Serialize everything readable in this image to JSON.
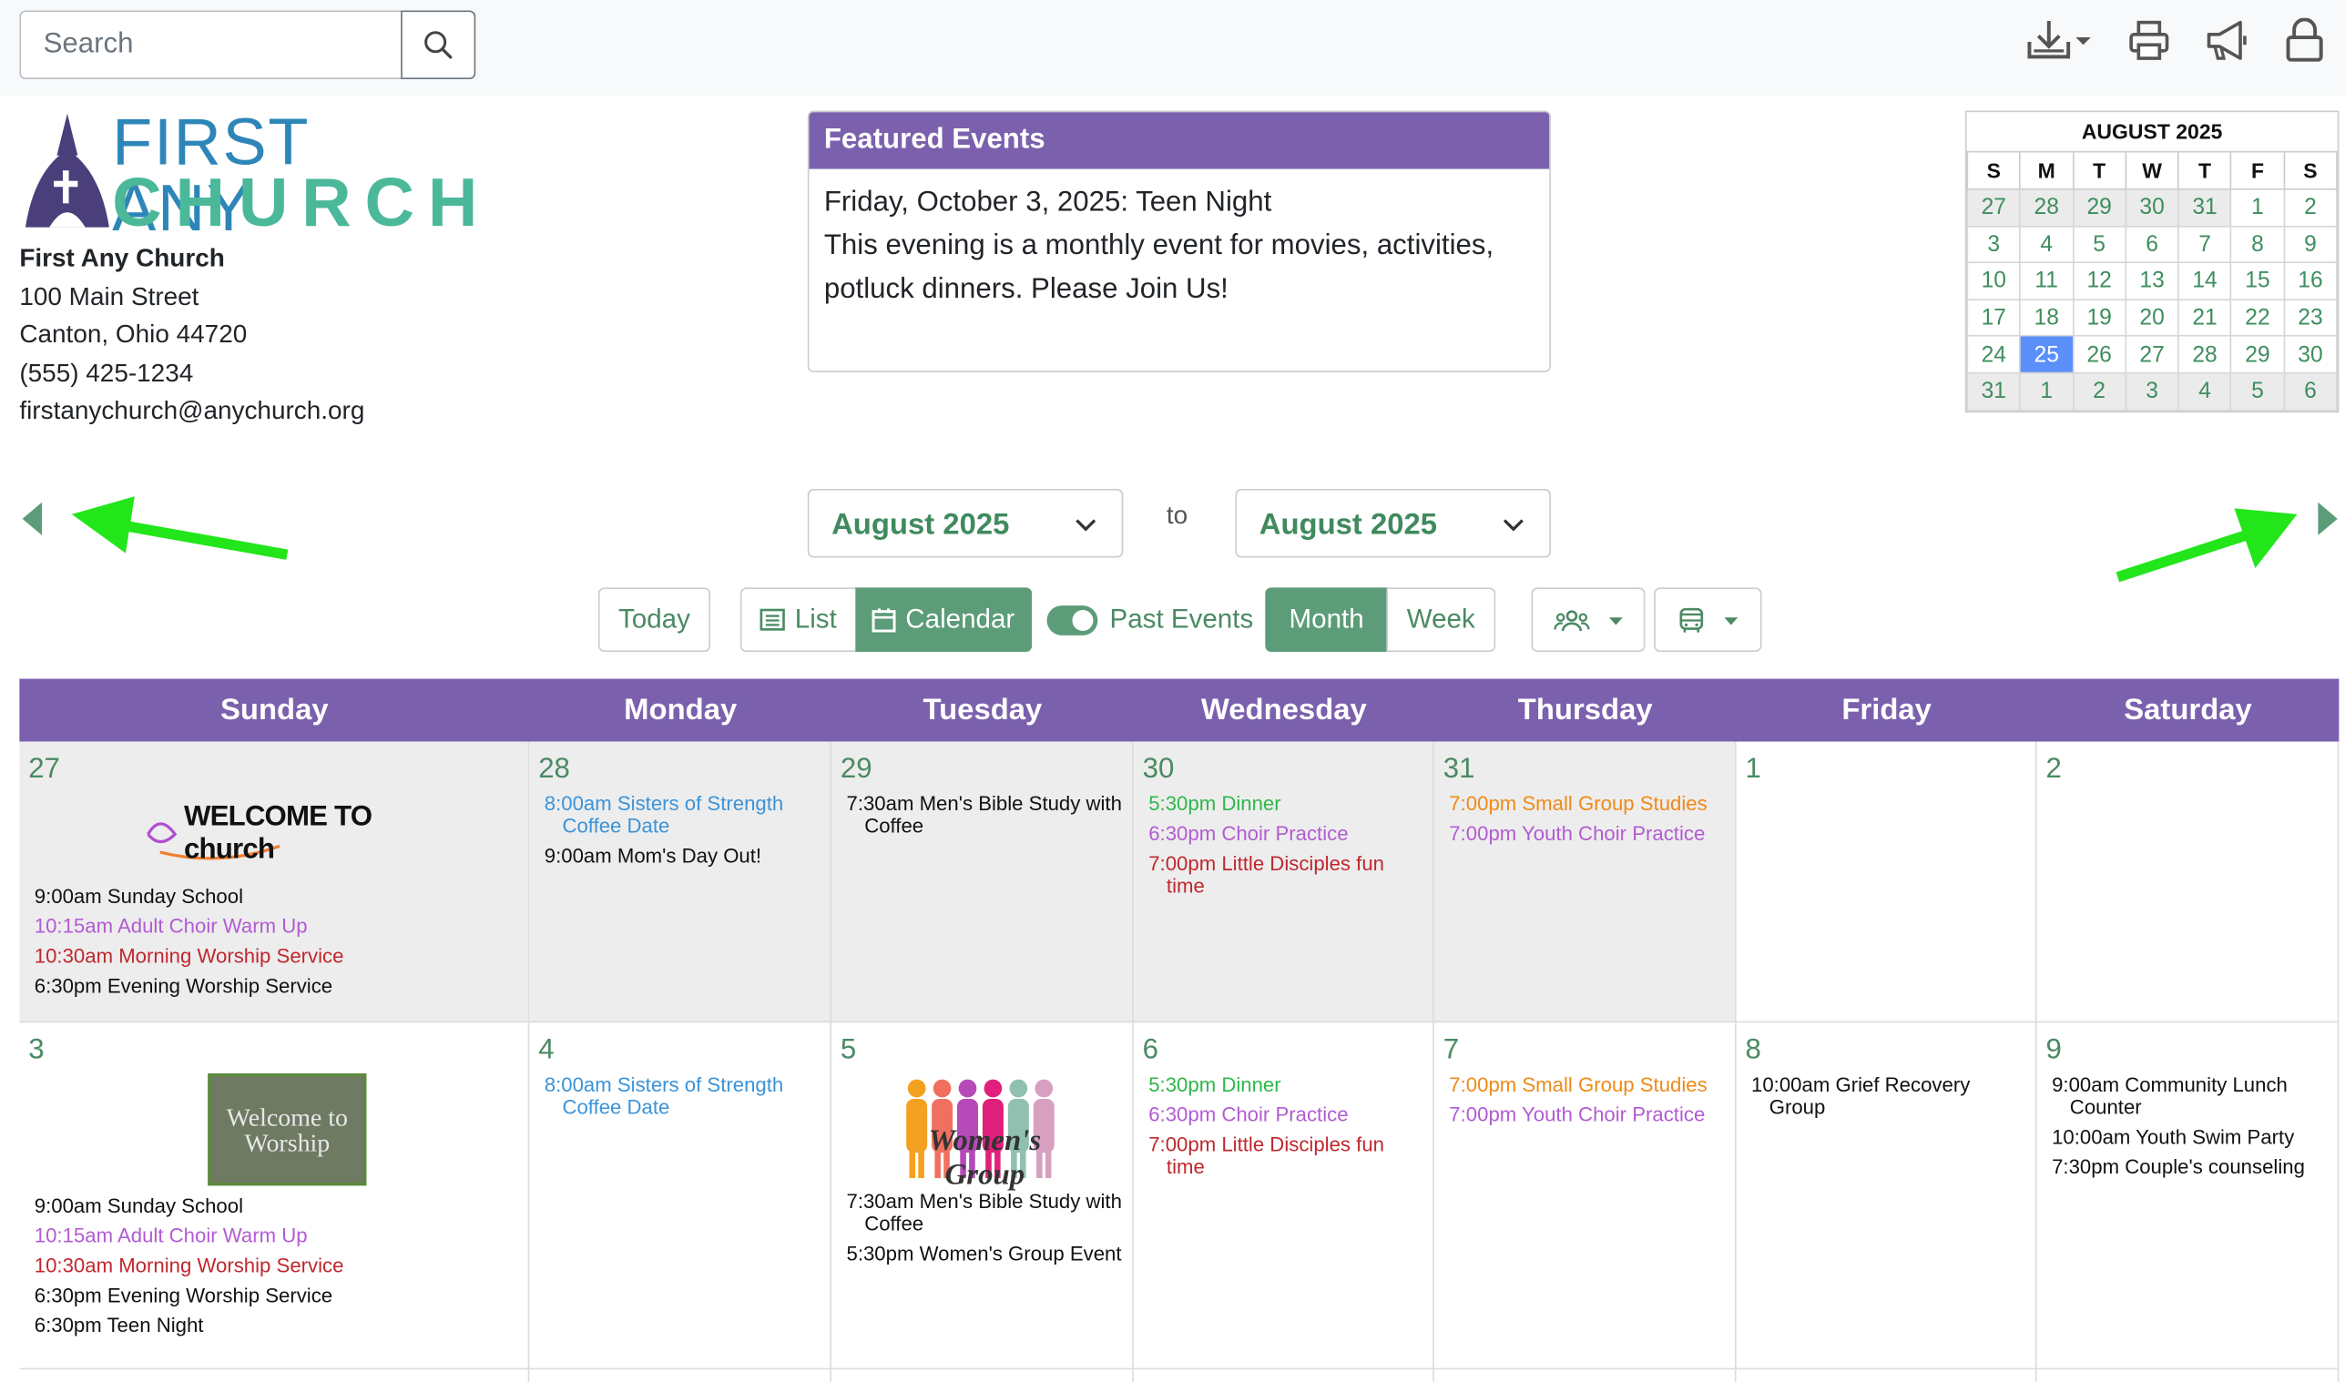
{
  "search": {
    "placeholder": "Search"
  },
  "church": {
    "logo_line1": "FIRST ANY",
    "logo_line2": "CHURCH",
    "name": "First Any Church",
    "address1": "100 Main Street",
    "address2": "Canton, Ohio 44720",
    "phone": "(555) 425-1234",
    "email": "firstanychurch@anychurch.org"
  },
  "featured": {
    "title": "Featured Events",
    "line1": "Friday, October 3, 2025: Teen Night",
    "line2": "This evening is a monthly event for movies, activities, potluck dinners. Please Join Us!"
  },
  "mini_calendar": {
    "title": "AUGUST 2025",
    "weekdays": [
      "S",
      "M",
      "T",
      "W",
      "T",
      "F",
      "S"
    ],
    "weeks": [
      [
        "27",
        "28",
        "29",
        "30",
        "31",
        "1",
        "2"
      ],
      [
        "3",
        "4",
        "5",
        "6",
        "7",
        "8",
        "9"
      ],
      [
        "10",
        "11",
        "12",
        "13",
        "14",
        "15",
        "16"
      ],
      [
        "17",
        "18",
        "19",
        "20",
        "21",
        "22",
        "23"
      ],
      [
        "24",
        "25",
        "26",
        "27",
        "28",
        "29",
        "30"
      ],
      [
        "31",
        "1",
        "2",
        "3",
        "4",
        "5",
        "6"
      ]
    ],
    "today": "25"
  },
  "range": {
    "from": "August 2025",
    "to_label": "to",
    "to": "August 2025"
  },
  "toolbar": {
    "today": "Today",
    "list": "List",
    "calendar": "Calendar",
    "past_events": "Past Events",
    "month": "Month",
    "week": "Week"
  },
  "calendar": {
    "days": [
      "Sunday",
      "Monday",
      "Tuesday",
      "Wednesday",
      "Thursday",
      "Friday",
      "Saturday"
    ],
    "image_texts": {
      "welcome_church": "WELCOME TO church",
      "welcome_worship": "Welcome to Worship",
      "womens_group": "Women's Group"
    },
    "week1": [
      {
        "day": "27",
        "events": [
          {
            "text": "9:00am Sunday School",
            "color": "black"
          },
          {
            "text": "10:15am Adult Choir Warm Up",
            "color": "purple"
          },
          {
            "text": "10:30am Morning Worship Service",
            "color": "red"
          },
          {
            "text": "6:30pm Evening Worship Service",
            "color": "black"
          }
        ]
      },
      {
        "day": "28",
        "events": [
          {
            "text": "8:00am Sisters of Strength Coffee Date",
            "color": "blue"
          },
          {
            "text": "9:00am Mom's Day Out!",
            "color": "black"
          }
        ]
      },
      {
        "day": "29",
        "events": [
          {
            "text": "7:30am Men's Bible Study with Coffee",
            "color": "black"
          }
        ]
      },
      {
        "day": "30",
        "events": [
          {
            "text": "5:30pm Dinner",
            "color": "green"
          },
          {
            "text": "6:30pm Choir Practice",
            "color": "purple"
          },
          {
            "text": "7:00pm Little Disciples fun time",
            "color": "red"
          }
        ]
      },
      {
        "day": "31",
        "events": [
          {
            "text": "7:00pm Small Group Studies",
            "color": "orange"
          },
          {
            "text": "7:00pm Youth Choir Practice",
            "color": "purple"
          }
        ]
      },
      {
        "day": "1",
        "events": []
      },
      {
        "day": "2",
        "events": []
      }
    ],
    "week2": [
      {
        "day": "3",
        "events": [
          {
            "text": "9:00am Sunday School",
            "color": "black"
          },
          {
            "text": "10:15am Adult Choir Warm Up",
            "color": "purple"
          },
          {
            "text": "10:30am Morning Worship Service",
            "color": "red"
          },
          {
            "text": "6:30pm Evening Worship Service",
            "color": "black"
          },
          {
            "text": "6:30pm Teen Night",
            "color": "black"
          }
        ]
      },
      {
        "day": "4",
        "events": [
          {
            "text": "8:00am Sisters of Strength Coffee Date",
            "color": "blue"
          }
        ]
      },
      {
        "day": "5",
        "events": [
          {
            "text": "7:30am Men's Bible Study with Coffee",
            "color": "black"
          },
          {
            "text": "5:30pm Women's Group Event",
            "color": "black"
          }
        ]
      },
      {
        "day": "6",
        "events": [
          {
            "text": "5:30pm Dinner",
            "color": "green"
          },
          {
            "text": "6:30pm Choir Practice",
            "color": "purple"
          },
          {
            "text": "7:00pm Little Disciples fun time",
            "color": "red"
          }
        ]
      },
      {
        "day": "7",
        "events": [
          {
            "text": "7:00pm Small Group Studies",
            "color": "orange"
          },
          {
            "text": "7:00pm Youth Choir Practice",
            "color": "purple"
          }
        ]
      },
      {
        "day": "8",
        "events": [
          {
            "text": "10:00am Grief Recovery Group",
            "color": "black"
          }
        ]
      },
      {
        "day": "9",
        "events": [
          {
            "text": "9:00am Community Lunch Counter",
            "color": "black"
          },
          {
            "text": "10:00am Youth Swim Party",
            "color": "black"
          },
          {
            "text": "7:30pm Couple's counseling",
            "color": "black"
          }
        ]
      }
    ]
  },
  "colors": {
    "accent_purple": "#7b61ad",
    "accent_green": "#5c9c78",
    "arrow_green": "#22e61a"
  }
}
